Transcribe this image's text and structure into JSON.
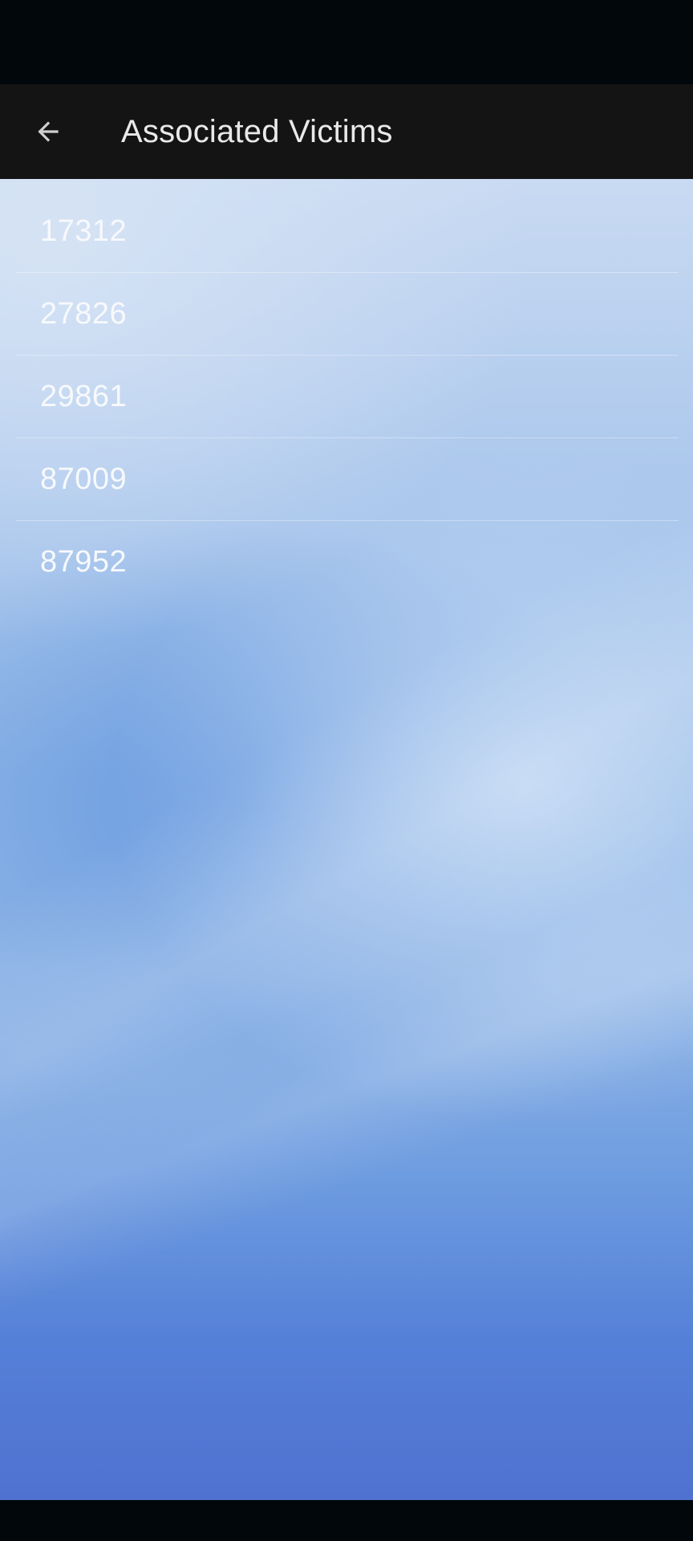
{
  "header": {
    "title": "Associated Victims",
    "back_icon": "arrow-left-icon"
  },
  "victims": [
    {
      "id": "17312"
    },
    {
      "id": "27826"
    },
    {
      "id": "29861"
    },
    {
      "id": "87009"
    },
    {
      "id": "87952"
    }
  ],
  "colors": {
    "app_bar": "#141414",
    "status_bar": "#02070b",
    "title_text": "#e9e9e9",
    "list_text": "#f7f9fc"
  }
}
